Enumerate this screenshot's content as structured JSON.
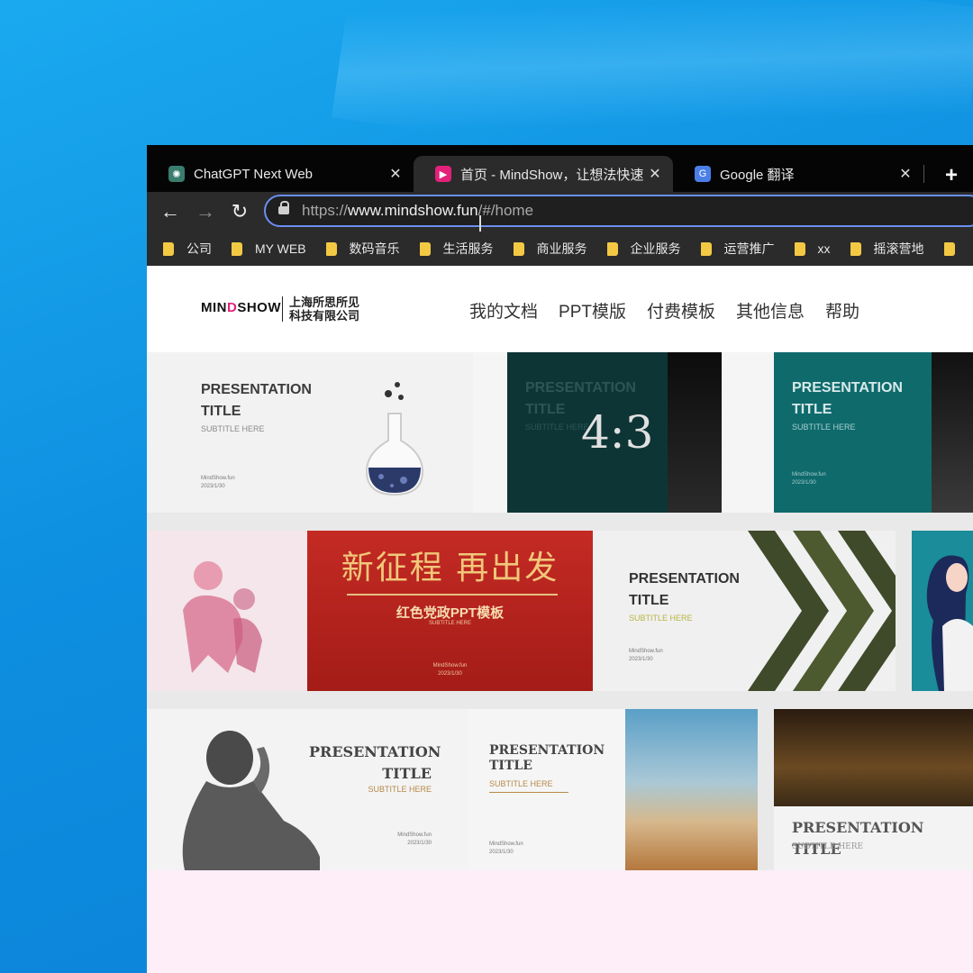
{
  "tabs": [
    {
      "title": "ChatGPT Next Web",
      "favicon": "chatgpt-icon"
    },
    {
      "title": "首页 - MindShow，让想法快速",
      "favicon": "mindshow-icon"
    },
    {
      "title": "Google 翻译",
      "favicon": "google-translate-icon"
    }
  ],
  "toolbar": {
    "url_scheme": "https://",
    "url_host": "www.mindshow.fun",
    "url_path": "/#/home"
  },
  "bookmarks": [
    "公司",
    "MY WEB",
    "数码音乐",
    "生活服务",
    "商业服务",
    "企业服务",
    "运营推广",
    "xx",
    "摇滚营地"
  ],
  "site": {
    "logo_pre": "MIN",
    "logo_mark": "D",
    "logo_post": "SHOW",
    "company_line1": "上海所思所见",
    "company_line2": "科技有限公司",
    "nav": [
      "我的文档",
      "PPT模版",
      "付费模板",
      "其他信息",
      "帮助"
    ]
  },
  "templates": {
    "t1_title1": "PRESENTATION",
    "t1_title2": "TITLE",
    "t1_sub": "SUBTITLE HERE",
    "t1_meta1": "MindShow.fun",
    "t1_meta2": "2023/1/30",
    "t2_title1": "PRESENTATION",
    "t2_title2": "TITLE",
    "t2_sub": "SUBTITLE HERE",
    "t2_ratio": "4:3",
    "t3_title1": "PRESENTATION",
    "t3_title2": "TITLE",
    "t3_sub": "SUBTITLE HERE",
    "t3_meta1": "MindShow.fun",
    "t3_meta2": "2023/1/30",
    "t5_big": "新征程 再出发",
    "t5_title": "红色党政PPT模板",
    "t5_sub": "SUBTITLE HERE",
    "t5_meta1": "MindShow.fun",
    "t5_meta2": "2023/1/30",
    "t6_title1": "PRESENTATION",
    "t6_title2": "TITLE",
    "t6_sub": "SUBTITLE HERE",
    "t6_meta1": "MindShow.fun",
    "t6_meta2": "2023/1/30",
    "t8_title1": "PRESENTATION",
    "t8_title2": "TITLE",
    "t8_sub": "SUBTITLE HERE",
    "t8_meta1": "MindShow.fun",
    "t8_meta2": "2023/1/30",
    "t9_title1": "PRESENTATION",
    "t9_title2": "TITLE",
    "t9_sub": "SUBTITLE HERE",
    "t9_meta1": "MindShow.fun",
    "t9_meta2": "2023/1/30",
    "t11_title": "PRESENTATION TITLE",
    "t11_sub": "SUBTITLE HERE"
  },
  "colors": {
    "accent": "#e3217a",
    "omnibox_focus": "#6b8ef0",
    "folder": "#f3c944",
    "page_bg": "#fdeef8"
  }
}
